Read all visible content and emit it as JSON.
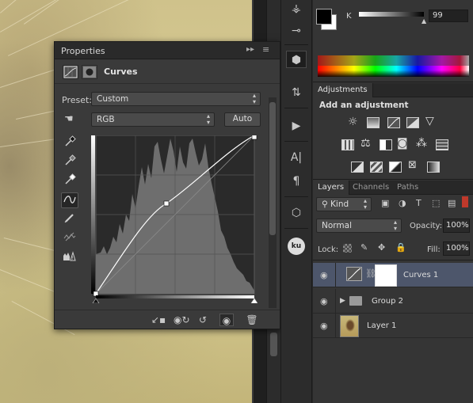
{
  "colors": {
    "canvas": "#d2c68c",
    "panel": "#3a3a3a",
    "selected_layer": "#4d566b",
    "accent": "#ffffff"
  },
  "properties_panel": {
    "title": "Properties",
    "heading": "Curves",
    "preset_label": "Preset:",
    "preset_value": "Custom",
    "channel_value": "RGB",
    "auto_button": "Auto",
    "tools": [
      "hand-adjust-icon",
      "eyedropper-black-icon",
      "eyedropper-gray-icon",
      "eyedropper-white-icon",
      "curve-point-icon",
      "pencil-icon",
      "smooth-icon",
      "clipping-warning-icon"
    ],
    "footer_icons": [
      "clip-to-layer-icon",
      "view-previous-icon",
      "reset-icon",
      "visibility-icon",
      "trash-icon"
    ]
  },
  "color_panel": {
    "channel_label": "K",
    "channel_value": "99"
  },
  "adjustments_panel": {
    "tab": "Adjustments",
    "subtitle": "Add an adjustment"
  },
  "layers_panel": {
    "tabs": [
      "Layers",
      "Channels",
      "Paths"
    ],
    "filter_value": "Kind",
    "blend_mode": "Normal",
    "opacity_label": "Opacity:",
    "opacity_value": "100%",
    "lock_label": "Lock:",
    "fill_label": "Fill:",
    "fill_value": "100%",
    "layers": [
      {
        "name": "Curves 1",
        "selected": true
      },
      {
        "name": "Group 2",
        "selected": false
      },
      {
        "name": "Layer 1",
        "selected": false
      }
    ]
  },
  "strip_icons": [
    "brushes-icon",
    "brush-presets-icon",
    "3d-icon",
    "properties-icon",
    "play-icon",
    "character-icon",
    "paragraph-icon",
    "cube-icon",
    "plugin-icon"
  ]
}
